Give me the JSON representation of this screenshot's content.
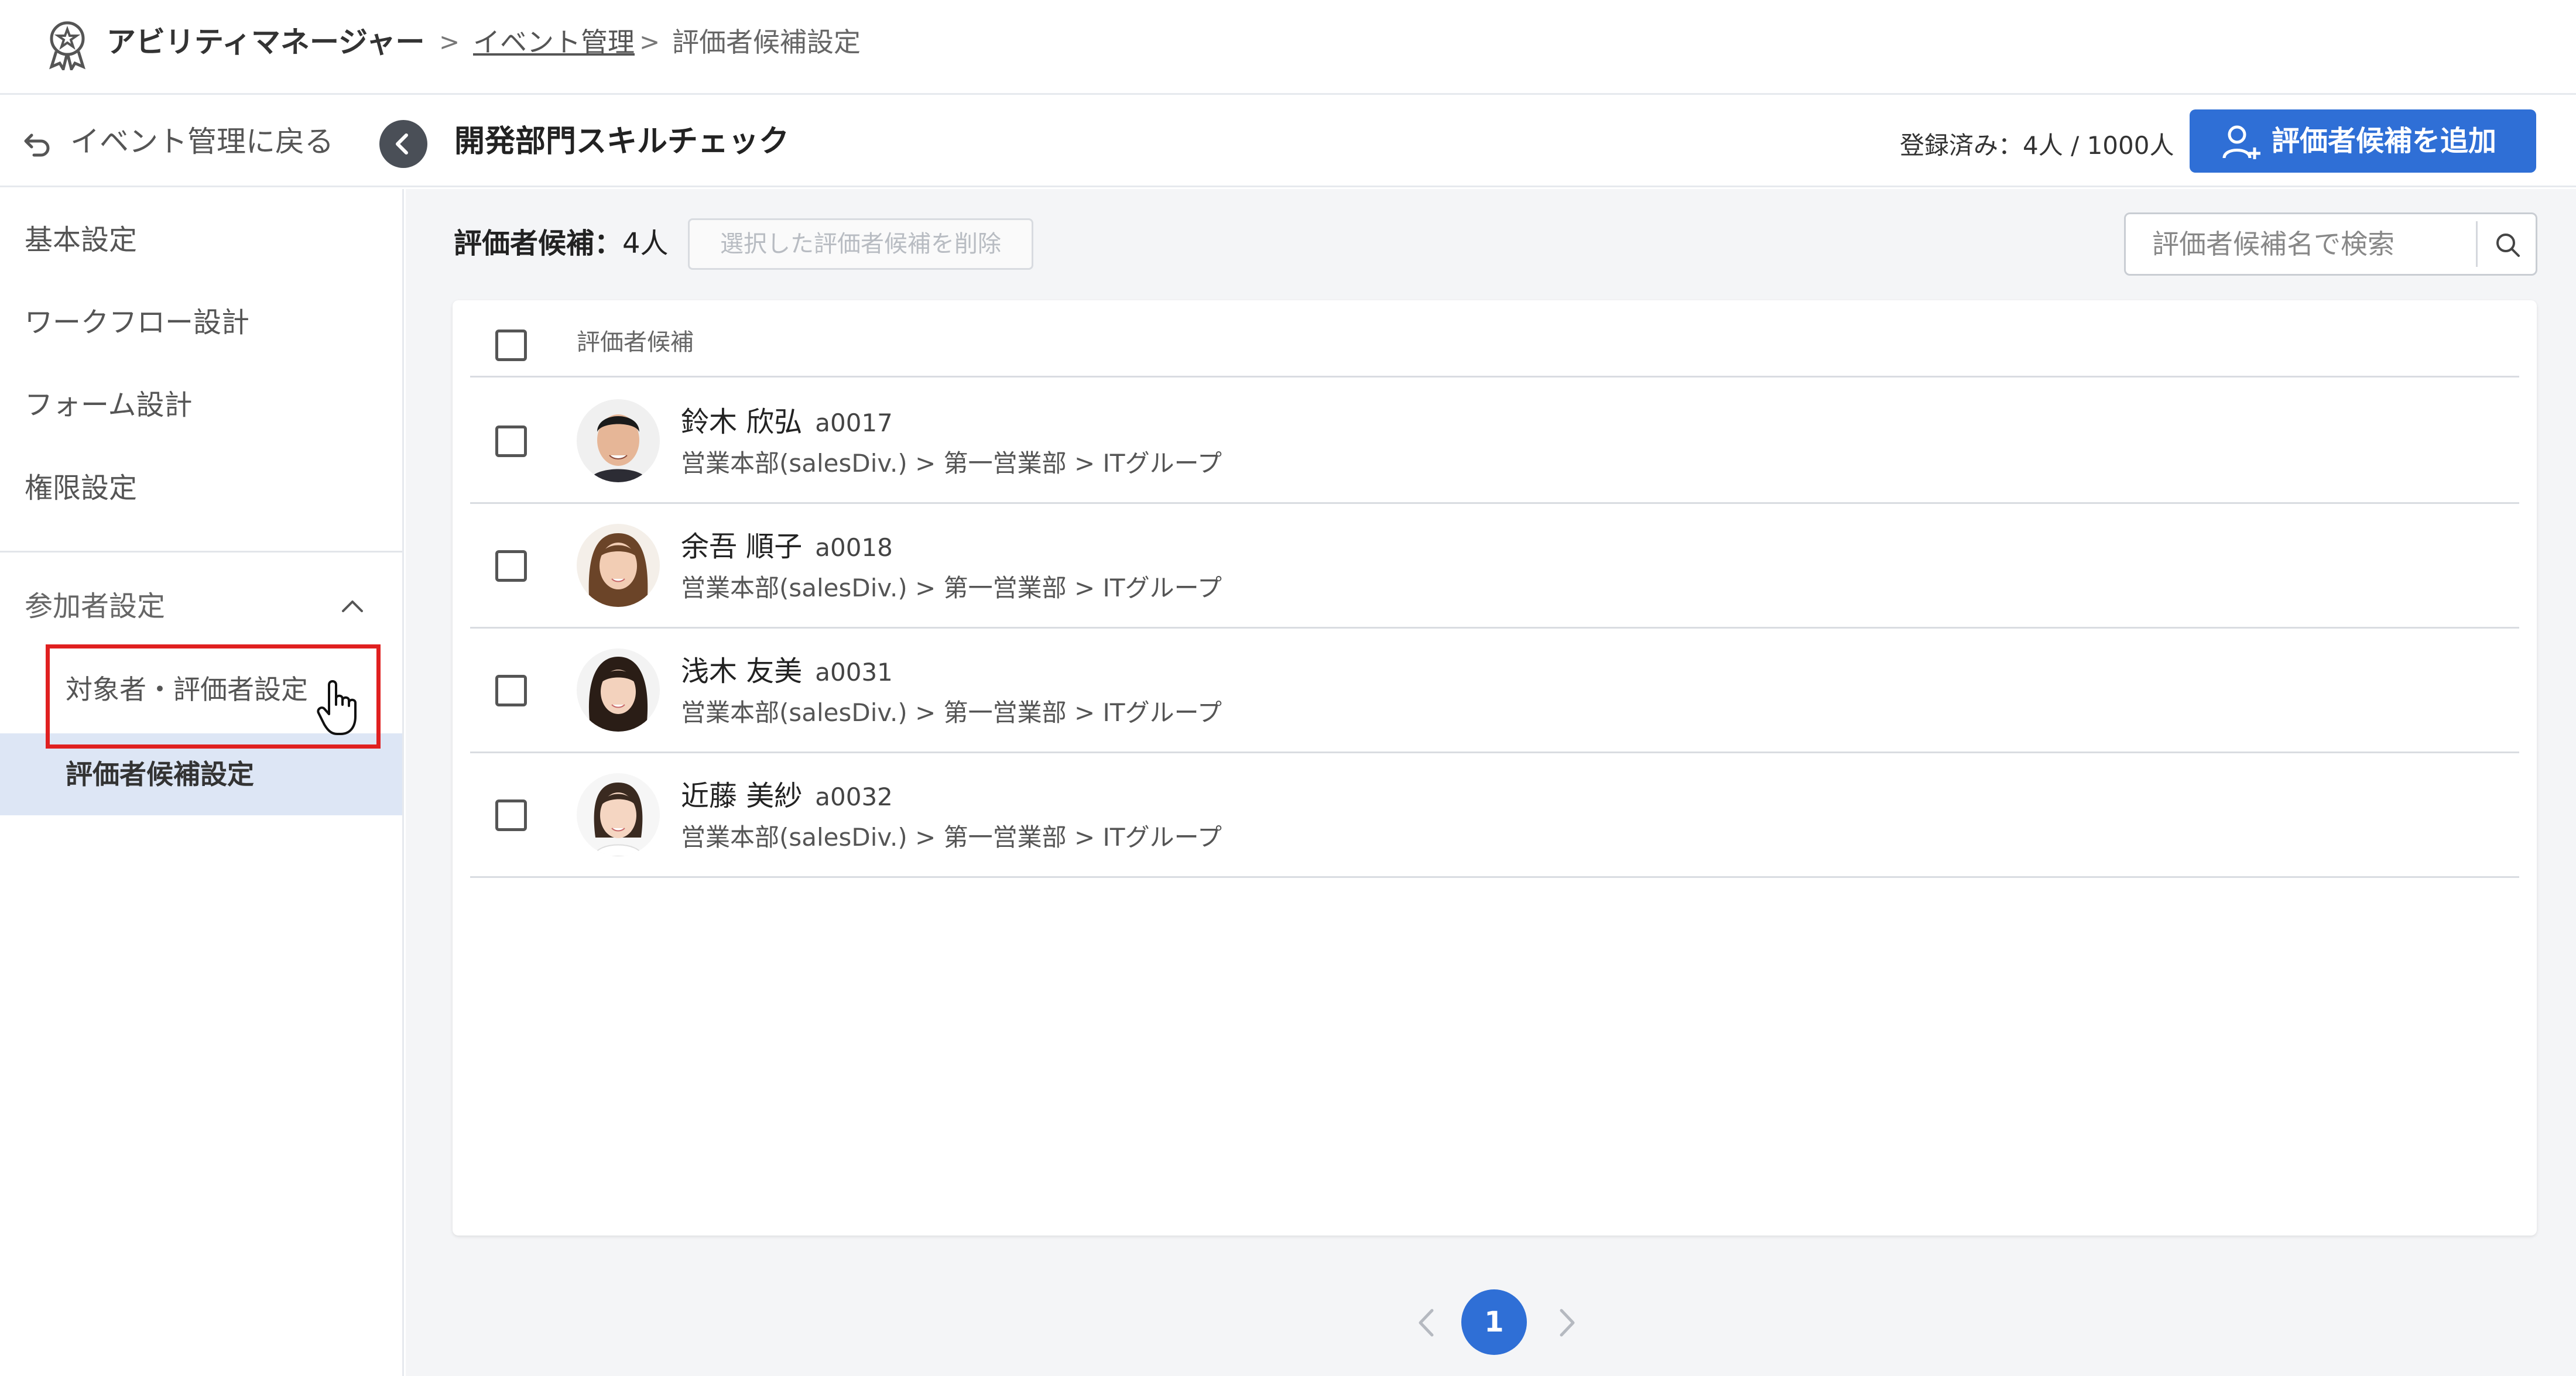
{
  "header": {
    "app_name": "アビリティマネージャー",
    "breadcrumb_sep": ">",
    "breadcrumb_link": "イベント管理",
    "breadcrumb_current": "評価者候補設定"
  },
  "subheader": {
    "back_label": "イベント管理に戻る",
    "event_title": "開発部門スキルチェック",
    "registered": "登録済み：4人 / 1000人",
    "add_button_label": "評価者候補を追加"
  },
  "sidebar": {
    "items": [
      "基本設定",
      "ワークフロー設計",
      "フォーム設計",
      "権限設定"
    ],
    "group_label": "参加者設定",
    "sub_items": [
      "対象者・評価者設定"
    ],
    "active_item": "評価者候補設定"
  },
  "main": {
    "count_label": "評価者候補：",
    "count_value": "4人",
    "delete_button_label": "選択した評価者候補を削除",
    "search_placeholder": "評価者候補名で検索",
    "column_header": "評価者候補",
    "rows": [
      {
        "name": "鈴木 欣弘",
        "code": "a0017",
        "dept": "営業本部(salesDiv.) > 第一営業部 > ITグループ"
      },
      {
        "name": "余吾 順子",
        "code": "a0018",
        "dept": "営業本部(salesDiv.) > 第一営業部 > ITグループ"
      },
      {
        "name": "浅木 友美",
        "code": "a0031",
        "dept": "営業本部(salesDiv.) > 第一営業部 > ITグループ"
      },
      {
        "name": "近藤 美紗",
        "code": "a0032",
        "dept": "営業本部(salesDiv.) > 第一営業部 > ITグループ"
      }
    ]
  },
  "pagination": {
    "current_page": "1"
  },
  "colors": {
    "accent": "#2f6fd6",
    "highlight": "#e02020",
    "active_bg": "#dde6f5"
  }
}
